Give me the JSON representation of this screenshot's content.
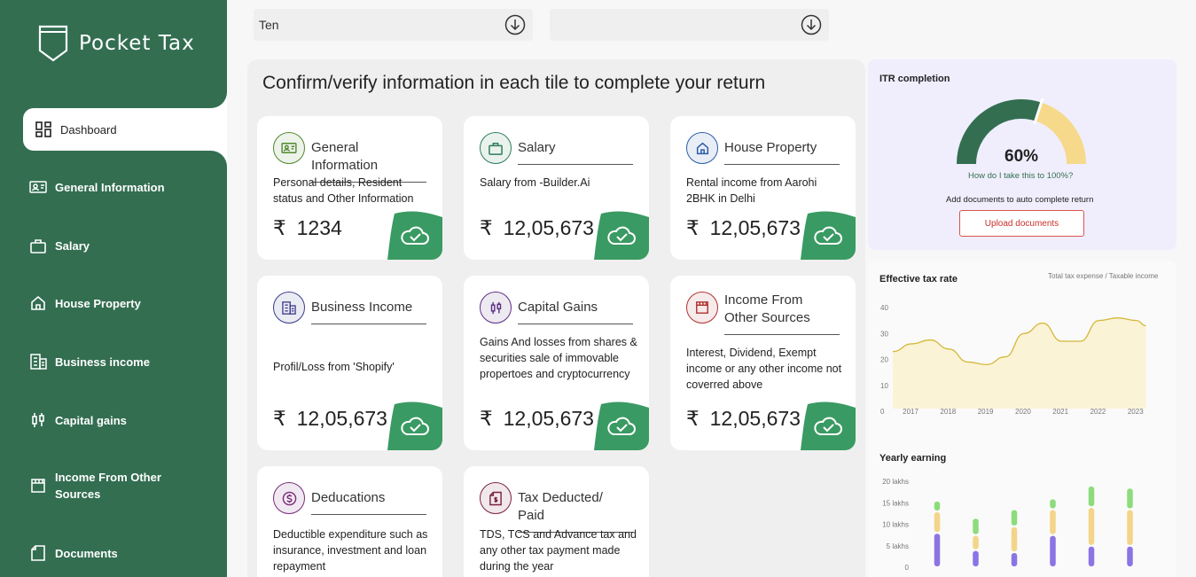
{
  "app": {
    "name": "Pocket Tax"
  },
  "nav": {
    "items": [
      {
        "label": "Dashboard"
      },
      {
        "label": "General Information"
      },
      {
        "label": "Salary"
      },
      {
        "label": "House Property"
      },
      {
        "label": "Business income"
      },
      {
        "label": "Capital gains"
      },
      {
        "label": "Income From Other Sources"
      },
      {
        "label": "Documents"
      }
    ]
  },
  "selects": [
    {
      "value": "Ten"
    },
    {
      "value": ""
    }
  ],
  "main": {
    "title": "Confirm/verify information in each tile to complete your return",
    "currency_symbol": "₹",
    "tiles": [
      {
        "title": "General Information",
        "desc": "Personal details, Resident status and Other Information",
        "amount": "1234",
        "icon": "id-card-icon",
        "color": "#4f8a2e"
      },
      {
        "title": "Salary",
        "desc": "Salary from -Builder.Ai",
        "amount": "12,05,673",
        "icon": "briefcase-icon",
        "color": "#2e7d5b"
      },
      {
        "title": "House Property",
        "desc": "Rental income from Aarohi 2BHK in Delhi",
        "amount": "12,05,673",
        "icon": "house-icon",
        "color": "#2a5caa"
      },
      {
        "title": "Business Income",
        "desc": "Profil/Loss from 'Shopify'",
        "amount": "12,05,673",
        "icon": "building-icon",
        "color": "#3c3c8c"
      },
      {
        "title": "Capital Gains",
        "desc": "Gains And losses from shares & securities sale of immovable propertoes and cryptocurrency",
        "amount": "12,05,673",
        "icon": "candlestick-icon",
        "color": "#5a2d82"
      },
      {
        "title": "Income From Other Sources",
        "desc": "Interest, Dividend, Exempt income or any other income not coverred above",
        "amount": "12,05,673",
        "icon": "store-icon",
        "color": "#b03030"
      },
      {
        "title": "Deducations",
        "desc": "Deductible expenditure such as insurance, investment and loan repayment",
        "amount": "",
        "icon": "dollar-coin-icon",
        "color": "#7a2a7a"
      },
      {
        "title": "Tax Deducted/ Paid",
        "desc": "TDS, TCS and Advance tax and any other tax payment made during the year",
        "amount": "",
        "icon": "receipt-icon",
        "color": "#7a2040"
      }
    ]
  },
  "itr": {
    "title": "ITR completion",
    "percent_label": "60%",
    "progress": 0.6,
    "help_link": "How do I take this to 100%?",
    "add_docs_text": "Add documents to auto complete return",
    "upload_label": "Upload documents",
    "colors": {
      "done": "#336e51",
      "remaining": "#f6d98a"
    }
  },
  "chart_data": [
    {
      "type": "area",
      "title": "Effective tax rate",
      "subtitle": "Total tax expense / Taxable income",
      "x": [
        2016.5,
        2017,
        2017.5,
        2018,
        2018.5,
        2019,
        2019.5,
        2020,
        2020.5,
        2021,
        2021.5,
        2022,
        2022.5,
        2023,
        2023.25
      ],
      "y": [
        23,
        26,
        27.5,
        24,
        19,
        18,
        21,
        30,
        34,
        27,
        27,
        35,
        36,
        35,
        33
      ],
      "xticks": [
        "2017",
        "2018",
        "2019",
        "2020",
        "2021",
        "2022",
        "2023"
      ],
      "yticks": [
        "0",
        "10",
        "20",
        "30",
        "40"
      ],
      "ylim": [
        0,
        40
      ],
      "colors": {
        "line": "#d4b83a",
        "fill": "#fbf3d6"
      }
    },
    {
      "type": "bar",
      "title": "Yearly earning",
      "yticks": [
        "0",
        "5 lakhs",
        "10 lakhs",
        "15 lakhs",
        "20 lakhs"
      ],
      "ylim": [
        0,
        20
      ],
      "series": [
        {
          "color": "#8b74e4",
          "values": [
            8,
            4,
            3.5,
            7.5,
            5,
            5
          ]
        },
        {
          "color": "#f3d58a",
          "values": [
            5,
            3.5,
            6,
            6,
            9,
            8.5
          ]
        },
        {
          "color": "#8ddc7c",
          "values": [
            2.5,
            4,
            4,
            2.5,
            5,
            5
          ]
        }
      ]
    }
  ]
}
